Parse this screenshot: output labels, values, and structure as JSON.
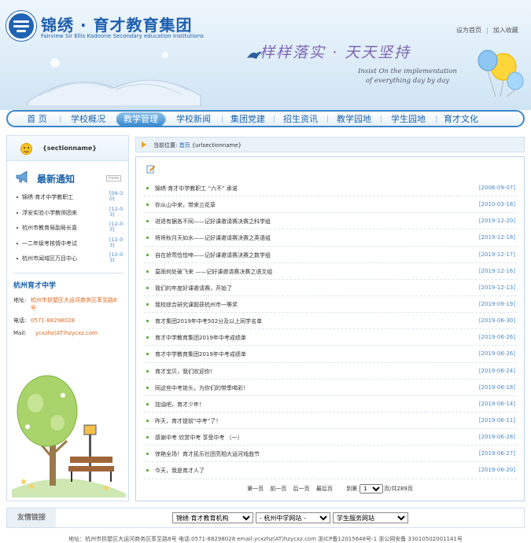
{
  "header": {
    "title": "锦绣 · 育才教育集团",
    "subtitle": "Fairview Sir Ellis Kadoorie Secondary education institutions",
    "top_links": [
      "设为首页",
      "加入收藏"
    ],
    "slogan": "样样落实 · 天天坚持",
    "slogan_en_1": "Insist On the implementation",
    "slogan_en_2": "of everything day by day"
  },
  "nav": {
    "items": [
      "首 页",
      "学校概况",
      "教学管理",
      "学校新闻",
      "集团党建",
      "招生资讯",
      "教学园地",
      "学生园地",
      "育才文化"
    ],
    "active_index": 2
  },
  "sidebar": {
    "section_name": "{sectionname}",
    "news_title": "最新通知",
    "more": "more",
    "news": [
      {
        "title": "锦绣·育才中学教职工",
        "date": "[09-30]"
      },
      {
        "title": "浮安实验小学教师团来",
        "date": "[12-03]"
      },
      {
        "title": "杭州市教育局副局长喜",
        "date": "[12-03]"
      },
      {
        "title": "一二年级考核情中考试",
        "date": "[12-03]"
      },
      {
        "title": "杭州市闻域区万目中心",
        "date": "[12-03]"
      }
    ],
    "contact": {
      "name": "杭州育才中学",
      "address_label": "地址:",
      "address": "杭州市拱墅区大运河商务区萃至路8号",
      "phone_label": "电话:",
      "phone": "0571-88298028",
      "mail_label": "Mail:",
      "mail": "ycxzhz(AT)hzycxz.com"
    }
  },
  "breadcrumb": {
    "label": "当前位置:",
    "home": "首页",
    "rest": "{urlsectionname}"
  },
  "articles": [
    {
      "title": "锦绣·育才中学教职工 “六不” 承诺",
      "date": "[2006-09-07]"
    },
    {
      "title": "你从山中来，带来兰花草",
      "date": "[2010-03-18]"
    },
    {
      "title": "进退有据各不同——记好课邀请赛决赛之科学组",
      "date": "[2019-12-20]"
    },
    {
      "title": "将将秋月天如水——记好课邀请赛决赛之英语组",
      "date": "[2019-12-18]"
    },
    {
      "title": "自在娇莺恰恰啼——记好课邀请赛决赛之数学组",
      "date": "[2019-12-17]"
    },
    {
      "title": "莫雨何处破飞来 ——记好课邀请赛决赛之语文组",
      "date": "[2019-12-16]"
    },
    {
      "title": "我们的年度好课邀请赛，开始了",
      "date": "[2019-12-13]"
    },
    {
      "title": "我校综合研究课题获杭州市一等奖",
      "date": "[2019-09-19]"
    },
    {
      "title": "育才集团2019年中考502分及以上同学名单",
      "date": "[2019-06-30]"
    },
    {
      "title": "育才中学教育集团2019年中考成绩单",
      "date": "[2019-06-26]"
    },
    {
      "title": "育才中学教育集团2019年中考成绩单",
      "date": "[2019-06-26]"
    },
    {
      "title": "育才宝贝，我们欢迎你！",
      "date": "[2019-06-24]"
    },
    {
      "title": "同这些中考锁头，为你们的带季喝彩！",
      "date": "[2019-06-18]"
    },
    {
      "title": "加油吧，育才少年！",
      "date": "[2019-06-14]"
    },
    {
      "title": "昨天，育才提前“中考”了！",
      "date": "[2019-06-11]"
    },
    {
      "title": "感谢中考 欣赏中考 享受中考 （一）",
      "date": "[2019-06-28]"
    },
    {
      "title": "惊艳全场！育才民乐社团亮相大运河戏曲节",
      "date": "[2019-06-27]"
    },
    {
      "title": "今天，我是育才人了",
      "date": "[2019-06-20]"
    }
  ],
  "pager": {
    "first": "第一页",
    "prev": "前一页",
    "next": "后一页",
    "last": "最后页",
    "goto": "到第",
    "current": "1",
    "suffix": "页/共289页"
  },
  "friend_links": {
    "label": "友情链接",
    "selects": [
      "锦绣·育才教育机构",
      "- 杭州中学网站 -",
      "学生服务网站"
    ]
  },
  "footer": "地址：杭州市拱墅区大运河商务区萃至路8号 电话:0571-88298028 email:ycxzhz(AT)hzycxz.com 浙ICP备12015648号-1 浙公网安备 33010502001141号",
  "colors": {
    "brand": "#1f5fae",
    "nav_active": "#3a88cc",
    "date": "#4a88c9",
    "accent_orange": "#e0661a"
  }
}
